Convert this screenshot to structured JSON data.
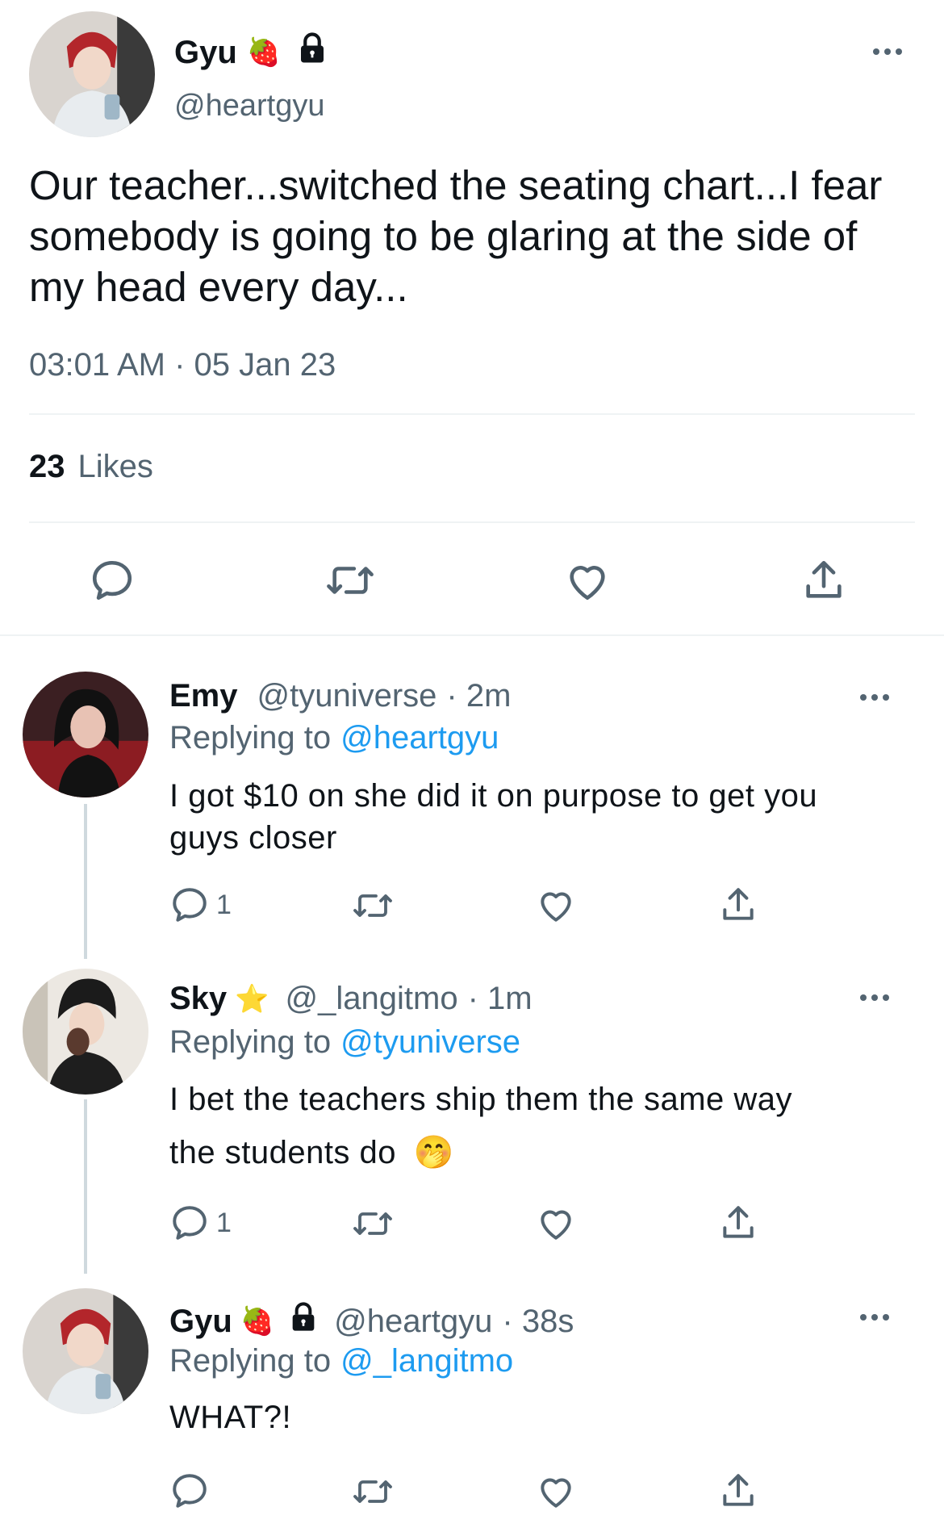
{
  "colors": {
    "accent": "#1d9bf0",
    "muted": "#536471",
    "text": "#0f1419",
    "divider": "#eff3f4"
  },
  "main_tweet": {
    "display_name": "Gyu",
    "handle": "@heartgyu",
    "name_emoji": "🍓",
    "lock_icon": "lock-icon",
    "text": "Our teacher...switched the seating chart...I fear somebody is going to be glaring at the side of my head every day...",
    "timestamp": "03:01 AM · 05 Jan 23",
    "likes_count": "23",
    "likes_label": "Likes"
  },
  "replies": [
    {
      "display_name": "Emy",
      "handle": "@tyuniverse",
      "time": "· 2m",
      "replying_label": "Replying to",
      "replying_to": "@heartgyu",
      "text": "I got $10 on she did it on purpose to get you guys closer",
      "reply_count": "1"
    },
    {
      "display_name": "Sky",
      "name_emoji": "⭐",
      "handle": "@_langitmo",
      "time": "· 1m",
      "replying_label": "Replying to",
      "replying_to": "@tyuniverse",
      "text_line1": "I bet the teachers ship them the same way",
      "text_line2": "the students do",
      "text_emoji": "🤭",
      "reply_count": "1"
    },
    {
      "display_name": "Gyu",
      "name_emoji": "🍓",
      "handle": "@heartgyu",
      "time": "· 38s",
      "replying_label": "Replying to",
      "replying_to": "@_langitmo",
      "text": "WHAT?!"
    }
  ]
}
